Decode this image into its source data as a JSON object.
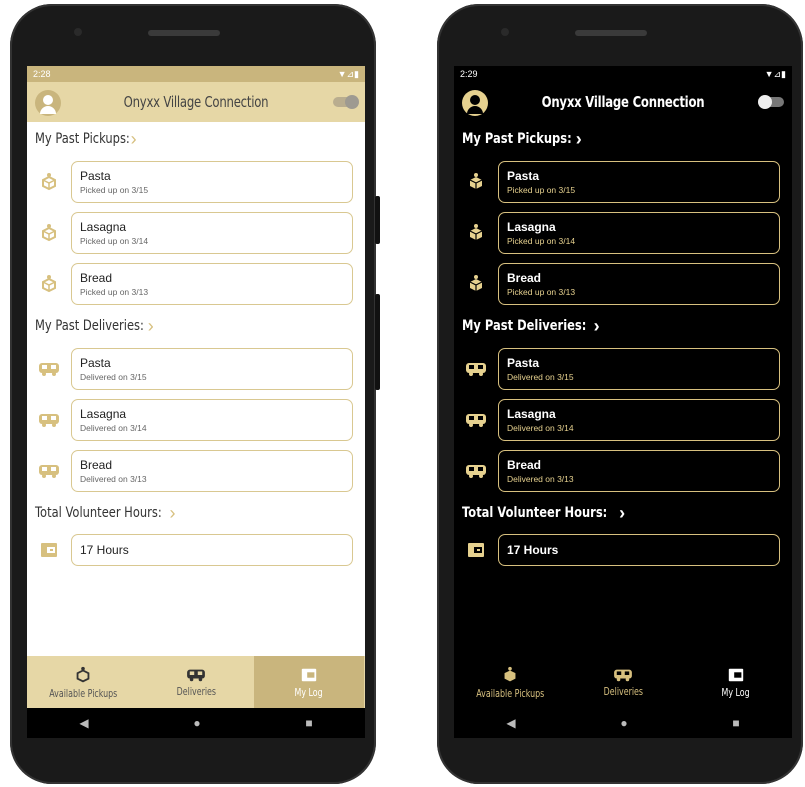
{
  "app": {
    "title": "Onyxx Village Connection"
  },
  "light": {
    "status": {
      "time": "2:28",
      "battery": "▼⊿▮"
    },
    "sections": {
      "pickups": {
        "title": "My Past Pickups:",
        "items": [
          {
            "title": "Pasta",
            "sub": "Picked up on 3/15"
          },
          {
            "title": "Lasagna",
            "sub": "Picked up on 3/14"
          },
          {
            "title": "Bread",
            "sub": "Picked up on 3/13"
          }
        ]
      },
      "deliveries": {
        "title": "My Past Deliveries:",
        "items": [
          {
            "title": "Pasta",
            "sub": "Delivered on 3/15"
          },
          {
            "title": "Lasagna",
            "sub": "Delivered on 3/14"
          },
          {
            "title": "Bread",
            "sub": "Delivered on 3/13"
          }
        ]
      },
      "hours": {
        "title": "Total Volunteer Hours:",
        "value": "17 Hours"
      }
    }
  },
  "dark": {
    "status": {
      "time": "2:29",
      "battery": "▼⊿▮"
    },
    "sections": {
      "pickups": {
        "title": "My Past Pickups:",
        "items": [
          {
            "title": "Pasta",
            "sub": "Picked up on 3/15"
          },
          {
            "title": "Lasagna",
            "sub": "Picked up on 3/14"
          },
          {
            "title": "Bread",
            "sub": "Picked up on 3/13"
          }
        ]
      },
      "deliveries": {
        "title": "My Past Deliveries:",
        "items": [
          {
            "title": "Pasta",
            "sub": "Delivered on 3/15"
          },
          {
            "title": "Lasagna",
            "sub": "Delivered on 3/14"
          },
          {
            "title": "Bread",
            "sub": "Delivered on 3/13"
          }
        ]
      },
      "hours": {
        "title": "Total Volunteer Hours:",
        "value": "17 Hours"
      }
    }
  },
  "nav": {
    "pickups": "Available Pickups",
    "deliveries": "Deliveries",
    "log": "My Log"
  },
  "sysnav": {
    "back": "◀",
    "home": "●",
    "recent": "■"
  },
  "chevron": "›",
  "icons": {
    "pickup": "package-hand-icon",
    "delivery": "van-icon",
    "hours": "wallet-icon"
  },
  "colors": {
    "gold": "#d7c07f",
    "light_bar": "#e6d7a6",
    "dark_bg": "#000000"
  }
}
